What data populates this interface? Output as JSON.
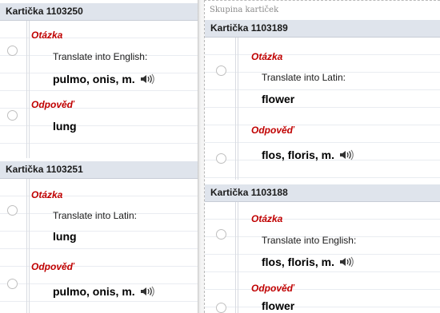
{
  "labels": {
    "question": "Otázka",
    "answer": "Odpověď",
    "group": "Skupina kartiček"
  },
  "icons": {
    "audio": "speaker-icon",
    "hole": "punch-hole"
  },
  "colors": {
    "header_bg": "#dfe4ec",
    "label_red": "#c00000"
  },
  "left_cards": [
    {
      "title": "Kartička 1103250",
      "prompt": "Translate into English:",
      "question_term": "pulmo, onis, m.",
      "answer_term": "lung"
    },
    {
      "title": "Kartička 1103251",
      "prompt": "Translate into Latin:",
      "question_term": "lung",
      "answer_term": "pulmo, onis, m."
    }
  ],
  "right_cards": [
    {
      "title": "Kartička 1103189",
      "prompt": "Translate into Latin:",
      "question_term": "flower",
      "answer_term": "flos, floris, m."
    },
    {
      "title": "Kartička 1103188",
      "prompt": "Translate into English:",
      "question_term": "flos, floris, m.",
      "answer_term": "flower"
    }
  ]
}
